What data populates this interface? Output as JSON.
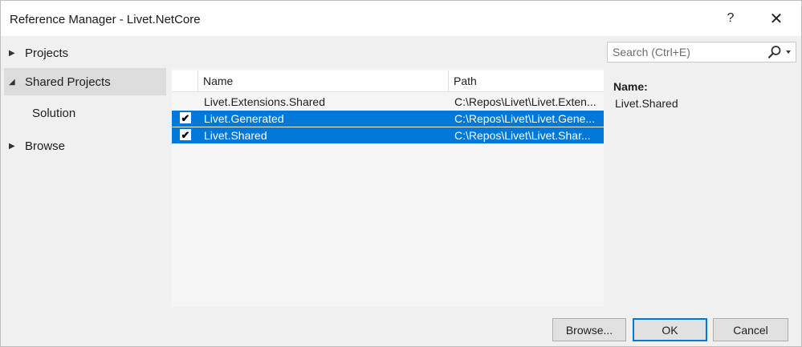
{
  "window": {
    "title": "Reference Manager - Livet.NetCore",
    "help_label": "?",
    "close_label": "✕"
  },
  "nav": {
    "items": [
      {
        "label": "Projects",
        "expanded": false,
        "selected": false
      },
      {
        "label": "Shared Projects",
        "expanded": true,
        "selected": true
      },
      {
        "label": "Browse",
        "expanded": false,
        "selected": false
      }
    ],
    "sub_items": [
      {
        "label": "Solution"
      }
    ]
  },
  "list": {
    "columns": [
      "Name",
      "Path"
    ],
    "rows": [
      {
        "checked": false,
        "selected": false,
        "name": "Livet.Extensions.Shared",
        "path": "C:\\Repos\\Livet\\Livet.Exten..."
      },
      {
        "checked": true,
        "selected": true,
        "name": "Livet.Generated",
        "path": "C:\\Repos\\Livet\\Livet.Gene..."
      },
      {
        "checked": true,
        "selected": true,
        "name": "Livet.Shared",
        "path": "C:\\Repos\\Livet\\Livet.Shar..."
      }
    ]
  },
  "search": {
    "placeholder": "Search (Ctrl+E)",
    "value": ""
  },
  "details": {
    "label": "Name:",
    "value": "Livet.Shared"
  },
  "buttons": {
    "browse": "Browse...",
    "ok": "OK",
    "cancel": "Cancel"
  },
  "colors": {
    "selection": "#0078d7",
    "nav_selected": "#dcdcdc",
    "window_bg": "#f0f0f0"
  },
  "icons": [
    "help-icon",
    "close-icon",
    "expand-arrow-icon",
    "collapse-arrow-icon",
    "search-icon",
    "dropdown-arrow-icon",
    "checkbox-checked-icon"
  ]
}
